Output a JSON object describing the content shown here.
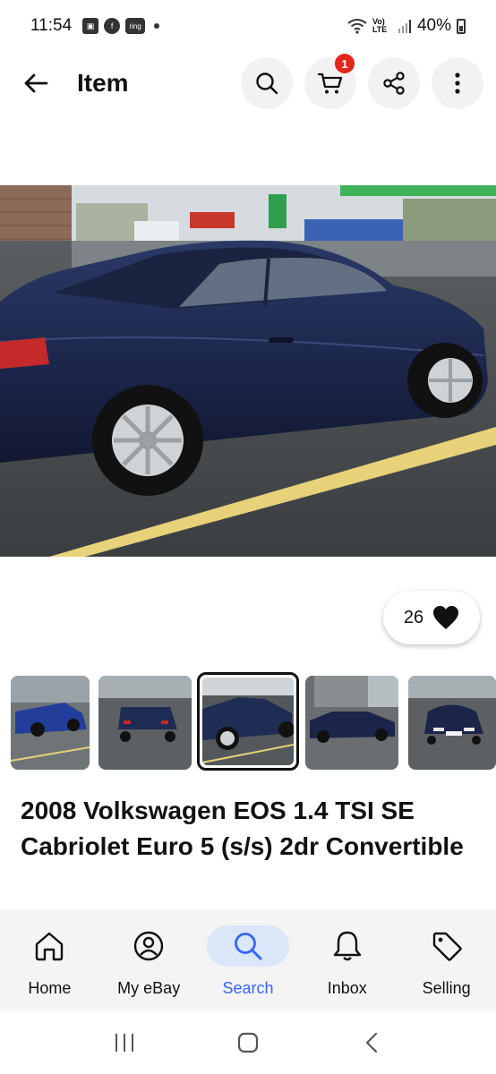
{
  "status_bar": {
    "time": "11:54",
    "ring_label": "ring",
    "network_label": "Vo) LTE",
    "battery": "40%"
  },
  "header": {
    "title": "Item",
    "cart_count": "1"
  },
  "listing": {
    "likes": "26",
    "title": "2008 Volkswagen EOS 1.4 TSI SE Cabriolet Euro 5 (s/s) 2dr Convertible",
    "thumbnails_count": 5,
    "selected_thumbnail": 3
  },
  "bottom_nav": [
    {
      "label": "Home",
      "icon": "home-icon"
    },
    {
      "label": "My eBay",
      "icon": "person-icon"
    },
    {
      "label": "Search",
      "icon": "search-icon",
      "active": true
    },
    {
      "label": "Inbox",
      "icon": "bell-icon"
    },
    {
      "label": "Selling",
      "icon": "tag-icon"
    }
  ],
  "colors": {
    "accent": "#3665f3",
    "badge": "#e0261d",
    "active_pill": "#dbe6f9",
    "car_paint": "#1f2d55"
  }
}
